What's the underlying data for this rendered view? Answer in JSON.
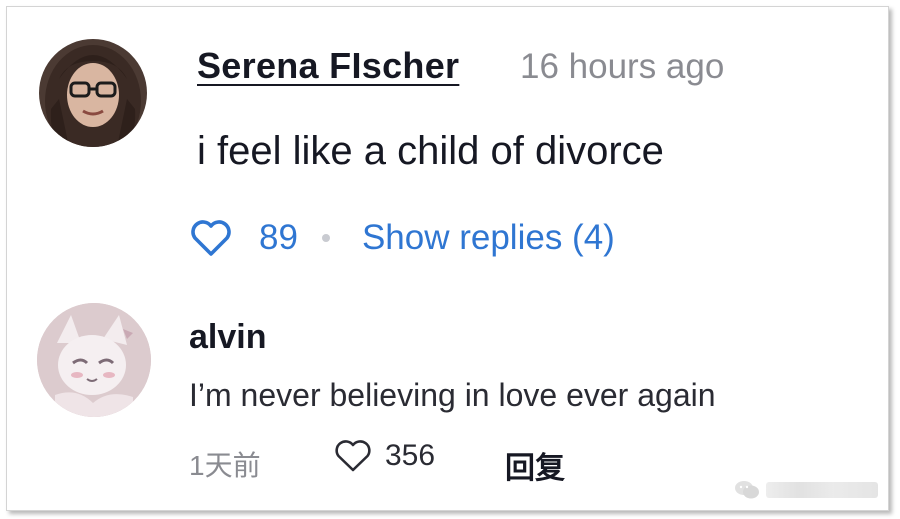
{
  "comments": [
    {
      "avatar_icon": "user-avatar-photo",
      "username": "Serena FIscher",
      "timestamp": "16 hours ago",
      "text": "i feel like a child of divorce",
      "like_icon": "heart-outline-icon",
      "likes": "89",
      "show_replies": "Show replies (4)",
      "accent_color": "#2f76d2"
    },
    {
      "avatar_icon": "anime-cat-avatar",
      "username": "alvin",
      "text": "I’m never believing in love ever again",
      "timestamp": "1天前",
      "like_icon": "heart-outline-icon",
      "likes": "356",
      "reply_label": "回复"
    }
  ],
  "watermark": {
    "icon": "wechat-icon"
  }
}
